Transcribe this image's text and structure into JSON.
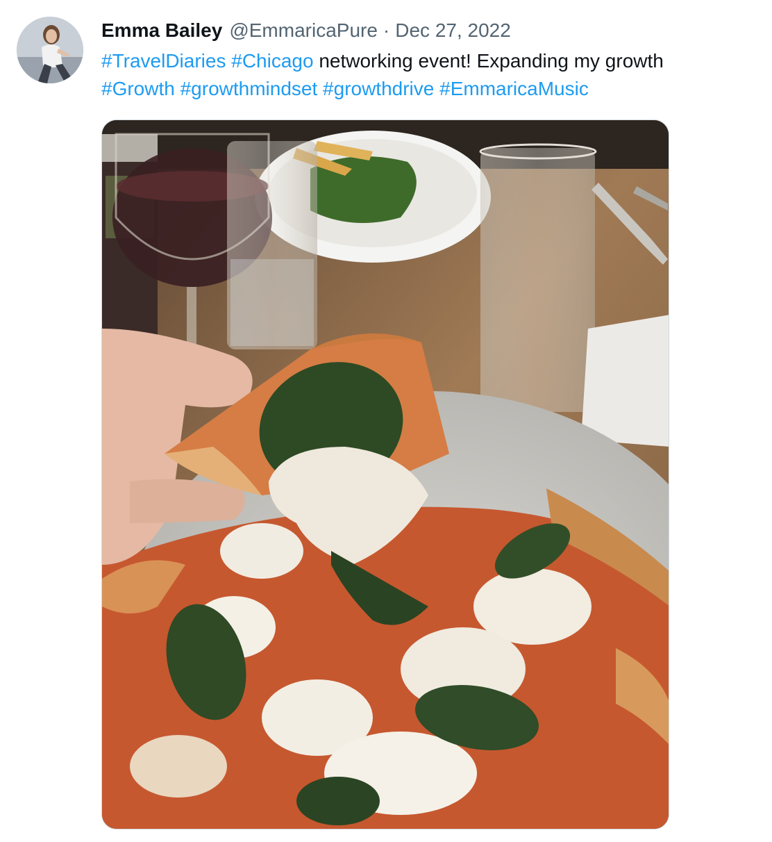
{
  "tweet": {
    "author": {
      "display_name": "Emma Bailey",
      "handle": "@EmmaricaPure",
      "separator": "·",
      "date": "Dec 27, 2022"
    },
    "text_line1": {
      "hashtag1": "#TravelDiaries",
      "hashtag2": "#Chicago",
      "plain": " networking event! Expanding my growth"
    },
    "text_line2": {
      "hashtag1": "#Growth",
      "hashtag2": "#growthmindset",
      "hashtag3": "#growthdrive",
      "hashtag4": "#EmmaricaMusic"
    },
    "media": {
      "icon": "photo-icon"
    }
  },
  "colors": {
    "text": "#0f1419",
    "secondary": "#536471",
    "accent": "#1d9bf0",
    "border": "#cfd9de"
  }
}
